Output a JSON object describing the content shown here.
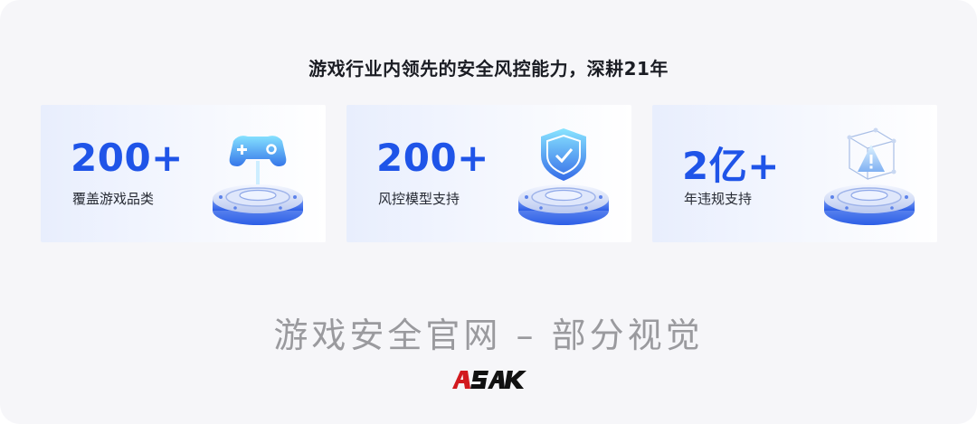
{
  "headline": "游戏行业内领先的安全风控能力，深耕21年",
  "cards": [
    {
      "stat": "200+",
      "label": "覆盖游戏品类",
      "icon": "gamepad-icon"
    },
    {
      "stat": "200+",
      "label": "风控模型支持",
      "icon": "shield-icon"
    },
    {
      "stat": "2亿+",
      "label": "年违规支持",
      "icon": "warning-cube-icon"
    }
  ],
  "subtitle": "游戏安全官网 – 部分视觉",
  "logo": {
    "text": "ASAK",
    "accent": "#d21a1f"
  },
  "colors": {
    "stat": "#1f54e8",
    "background": "#f6f6f9",
    "subtitle": "#9a9a9e"
  }
}
